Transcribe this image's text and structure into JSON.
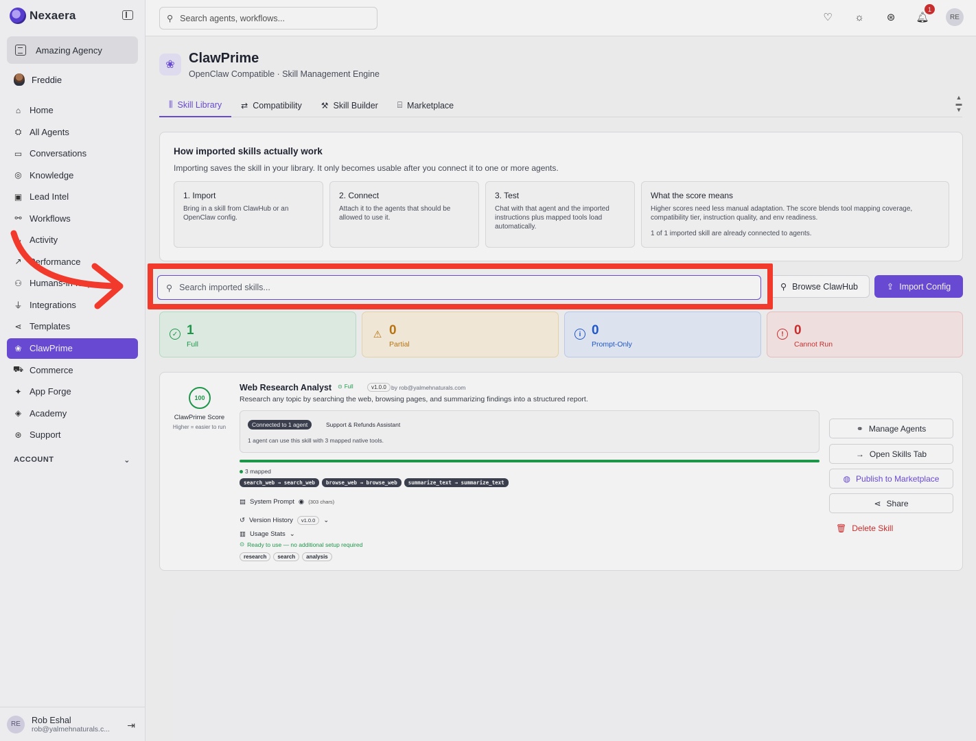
{
  "brand": {
    "name": "Nexaera"
  },
  "org": {
    "name": "Amazing Agency"
  },
  "current_user": {
    "name": "Freddie"
  },
  "nav": [
    {
      "label": "Home",
      "icon": "home-icon",
      "glyph": "⌂"
    },
    {
      "label": "All Agents",
      "icon": "robot-icon",
      "glyph": "⛭"
    },
    {
      "label": "Conversations",
      "icon": "chat-icon",
      "glyph": "▭"
    },
    {
      "label": "Knowledge",
      "icon": "brain-icon",
      "glyph": "◎"
    },
    {
      "label": "Lead Intel",
      "icon": "contact-icon",
      "glyph": "▣"
    },
    {
      "label": "Workflows",
      "icon": "workflow-icon",
      "glyph": "⚯"
    },
    {
      "label": "Activity",
      "icon": "activity-icon",
      "glyph": "∿"
    },
    {
      "label": "Performance",
      "icon": "trend-icon",
      "glyph": "↗"
    },
    {
      "label": "Humans-in-loop",
      "icon": "people-icon",
      "glyph": "⚇"
    },
    {
      "label": "Integrations",
      "icon": "plug-icon",
      "glyph": "⏚"
    },
    {
      "label": "Templates",
      "icon": "share-nodes-icon",
      "glyph": "⋖"
    },
    {
      "label": "ClawPrime",
      "icon": "clawprime-icon",
      "glyph": "❀",
      "active": true
    },
    {
      "label": "Commerce",
      "icon": "cart-icon",
      "glyph": "⛟"
    },
    {
      "label": "App Forge",
      "icon": "sparkles-icon",
      "glyph": "✦"
    },
    {
      "label": "Academy",
      "icon": "graduation-icon",
      "glyph": "◈"
    },
    {
      "label": "Support",
      "icon": "lifebuoy-icon",
      "glyph": "⊛"
    }
  ],
  "account_label": "ACCOUNT",
  "footer_user": {
    "initials": "RE",
    "name": "Rob Eshal",
    "email": "rob@yalmehnaturals.c..."
  },
  "topbar": {
    "search_placeholder": "Search agents, workflows...",
    "notifications_count": "1",
    "avatar_initials": "RE"
  },
  "page": {
    "title": "ClawPrime",
    "subtitle": "OpenClaw Compatible · Skill Management Engine"
  },
  "tabs": [
    {
      "label": "Skill Library",
      "icon": "library-icon",
      "glyph": "⫼",
      "active": true
    },
    {
      "label": "Compatibility",
      "icon": "compare-icon",
      "glyph": "⇄"
    },
    {
      "label": "Skill Builder",
      "icon": "wrench-icon",
      "glyph": "⚒"
    },
    {
      "label": "Marketplace",
      "icon": "store-icon",
      "glyph": "⌸"
    }
  ],
  "info": {
    "title": "How imported skills actually work",
    "desc": "Importing saves the skill in your library. It only becomes usable after you connect it to one or more agents.",
    "steps": [
      {
        "title": "1. Import",
        "text": "Bring in a skill from ClawHub or an OpenClaw config."
      },
      {
        "title": "2. Connect",
        "text": "Attach it to the agents that should be allowed to use it."
      },
      {
        "title": "3. Test",
        "text": "Chat with that agent and the imported instructions plus mapped tools load automatically."
      }
    ],
    "score": {
      "title": "What the score means",
      "text": "Higher scores need less manual adaptation. The score blends tool mapping coverage, compatibility tier, instruction quality, and env readiness.",
      "note": "1 of 1 imported skill are already connected to agents."
    }
  },
  "skills_search": {
    "placeholder": "Search imported skills..."
  },
  "buttons": {
    "browse": "Browse ClawHub",
    "import": "Import Config"
  },
  "stats": [
    {
      "value": "1",
      "label": "Full",
      "color": "#1e9e4d"
    },
    {
      "value": "0",
      "label": "Partial",
      "color": "#c07a12"
    },
    {
      "value": "0",
      "label": "Prompt-Only",
      "color": "#1f5bd6"
    },
    {
      "value": "0",
      "label": "Cannot Run",
      "color": "#d32f2f"
    }
  ],
  "skill": {
    "score": "100",
    "score_label": "ClawPrime Score",
    "score_hint": "Higher = easier to run",
    "name": "Web Research Analyst",
    "tier": "Full",
    "version": "v1.0.0",
    "author": "by rob@yalmehnaturals.com",
    "description": "Research any topic by searching the web, browsing pages, and summarizing findings into a structured report.",
    "connected_pill": "Connected to 1 agent",
    "connected_agent": "Support & Refunds Assistant",
    "connected_text": "1 agent can use this skill with 3 mapped native tools.",
    "mapping_progress": 1.0,
    "mapped_label": "3 mapped",
    "tools": [
      "search_web → search_web",
      "browse_web → browse_web",
      "summarize_text → summarize_text"
    ],
    "system_prompt_label": "System Prompt",
    "system_prompt_chars": "(303 chars)",
    "version_history_label": "Version History",
    "usage_stats_label": "Usage Stats",
    "ready_text": "Ready to use — no additional setup required",
    "tags": [
      "research",
      "search",
      "analysis"
    ],
    "actions": {
      "manage_agents": "Manage Agents",
      "open_tab": "Open Skills Tab",
      "publish": "Publish to Marketplace",
      "share": "Share",
      "delete": "Delete Skill"
    }
  },
  "colors": {
    "accent": "#6d4cdc",
    "highlight": "#f23a2c",
    "success": "#1e9e4d"
  }
}
